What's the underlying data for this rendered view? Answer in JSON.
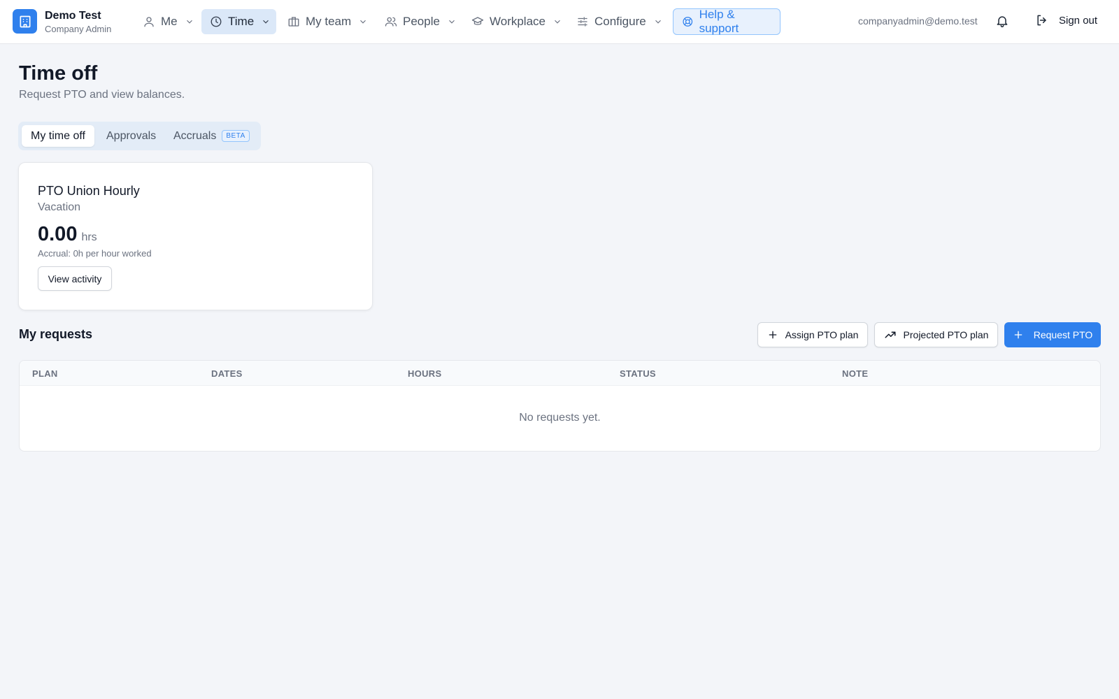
{
  "brand": {
    "name": "Demo Test",
    "role": "Company Admin"
  },
  "nav": {
    "me": "Me",
    "time": "Time",
    "my_team": "My team",
    "people": "People",
    "workplace": "Workplace",
    "configure": "Configure",
    "help": "Help & support"
  },
  "user": {
    "email": "companyadmin@demo.test",
    "signout": "Sign out"
  },
  "page": {
    "title": "Time off",
    "subtitle": "Request PTO and view balances."
  },
  "tabs": {
    "my_time_off": "My time off",
    "approvals": "Approvals",
    "accruals": "Accruals",
    "beta": "BETA"
  },
  "card": {
    "title": "PTO Union Hourly",
    "subtitle": "Vacation",
    "balance": "0.00",
    "unit": "hrs",
    "accrual": "Accrual: 0h per hour worked",
    "view_activity": "View activity"
  },
  "requests": {
    "title": "My requests",
    "assign": "Assign PTO plan",
    "projected": "Projected PTO plan",
    "request": "Request PTO",
    "columns": [
      "PLAN",
      "DATES",
      "HOURS",
      "STATUS",
      "NOTE"
    ],
    "empty": "No requests yet."
  },
  "colors": {
    "accent": "#2f80ed",
    "background": "#f3f5f9",
    "active_nav": "#dbe8f8"
  },
  "icons": [
    "building-icon",
    "user-icon",
    "clock-icon",
    "briefcase-icon",
    "users-icon",
    "graduation-cap-icon",
    "sliders-icon",
    "lifebuoy-icon",
    "bell-icon",
    "logout-icon",
    "plus-icon",
    "trending-up-icon",
    "chevron-down-icon"
  ]
}
